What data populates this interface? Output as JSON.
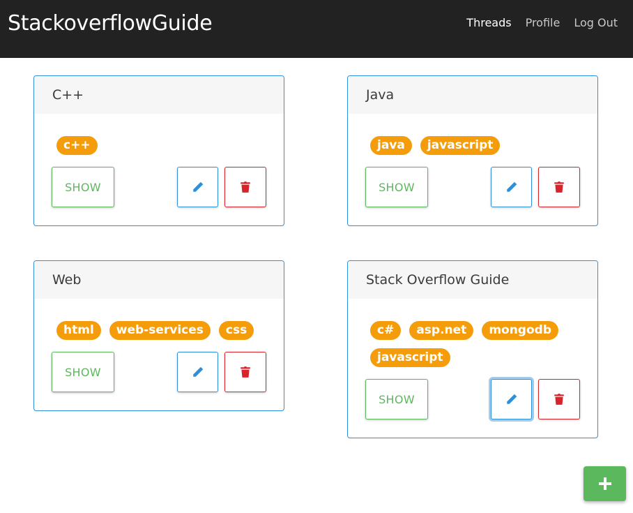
{
  "app": {
    "brand": "StackoverflowGuide"
  },
  "nav": {
    "items": [
      {
        "label": "Threads",
        "active": true
      },
      {
        "label": "Profile",
        "active": false
      },
      {
        "label": "Log Out",
        "active": false
      }
    ]
  },
  "threads": [
    {
      "title": "C++",
      "tags": [
        "c++"
      ],
      "show_label": "SHOW"
    },
    {
      "title": "Java",
      "tags": [
        "java",
        "javascript"
      ],
      "show_label": "SHOW"
    },
    {
      "title": "Web",
      "tags": [
        "html",
        "web-services",
        "css"
      ],
      "show_label": "SHOW"
    },
    {
      "title": "Stack Overflow Guide",
      "tags": [
        "c#",
        "asp.net",
        "mongodb",
        "javascript"
      ],
      "show_label": "SHOW"
    }
  ],
  "icons": {
    "edit": "pencil-icon",
    "delete": "trash-icon",
    "add": "plus-icon"
  },
  "colors": {
    "navbar": "#222222",
    "primary": "#2f8fd8",
    "success": "#5cb85c",
    "danger": "#d9232b",
    "tag": "#f59c0a"
  }
}
